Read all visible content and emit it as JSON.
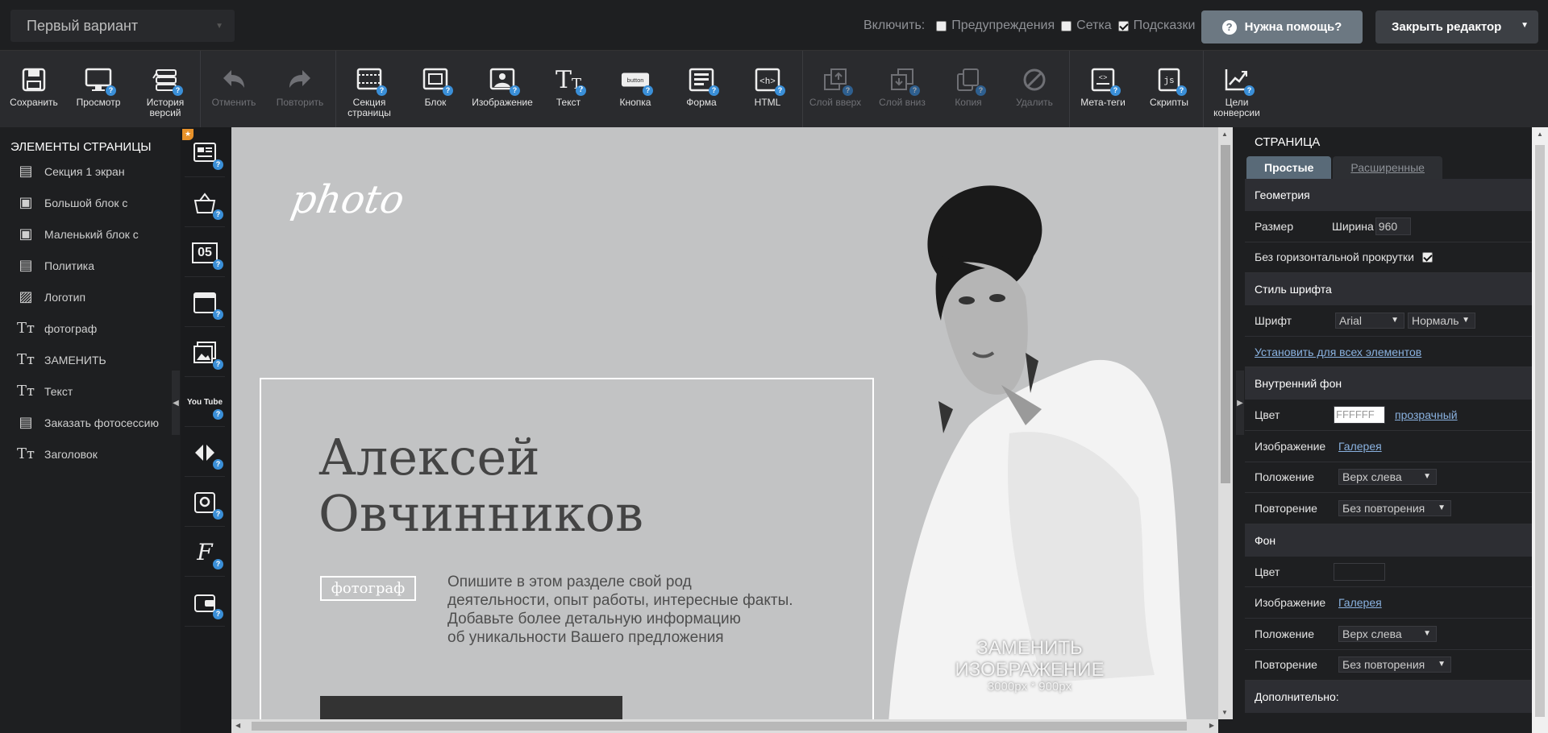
{
  "topbar": {
    "variant": "Первый вариант",
    "toggles_label": "Включить:",
    "toggles": [
      {
        "label": "Предупреждения",
        "checked": false
      },
      {
        "label": "Сетка",
        "checked": false
      },
      {
        "label": "Подсказки",
        "checked": true
      }
    ],
    "help_label": "Нужна помощь?",
    "close_label": "Закрыть редактор"
  },
  "toolbar": {
    "items": [
      {
        "label": "Сохранить",
        "icon": "save-icon",
        "disabled": false
      },
      {
        "label": "Просмотр",
        "icon": "monitor-icon",
        "disabled": false
      },
      {
        "label": "История версий",
        "icon": "history-icon",
        "disabled": false
      },
      {
        "label": "Отменить",
        "icon": "undo-icon",
        "disabled": true
      },
      {
        "label": "Повторить",
        "icon": "redo-icon",
        "disabled": true
      },
      {
        "label": "Секция страницы",
        "icon": "section-icon",
        "disabled": false
      },
      {
        "label": "Блок",
        "icon": "block-icon",
        "disabled": false
      },
      {
        "label": "Изображение",
        "icon": "image-icon",
        "disabled": false
      },
      {
        "label": "Текст",
        "icon": "text-icon",
        "disabled": false
      },
      {
        "label": "Кнопка",
        "icon": "button-icon",
        "disabled": false
      },
      {
        "label": "Форма",
        "icon": "form-icon",
        "disabled": false
      },
      {
        "label": "HTML",
        "icon": "html-icon",
        "disabled": false
      },
      {
        "label": "Слой вверх",
        "icon": "layer-up-icon",
        "disabled": true
      },
      {
        "label": "Слой вниз",
        "icon": "layer-down-icon",
        "disabled": true
      },
      {
        "label": "Копия",
        "icon": "copy-icon",
        "disabled": true
      },
      {
        "label": "Удалить",
        "icon": "delete-icon",
        "disabled": true
      },
      {
        "label": "Мета-теги",
        "icon": "meta-tags-icon",
        "disabled": false
      },
      {
        "label": "Скрипты",
        "icon": "scripts-icon",
        "disabled": false
      },
      {
        "label": "Цели конверсии",
        "icon": "conversion-icon",
        "disabled": false
      }
    ]
  },
  "left_panel": {
    "title": "ЭЛЕМЕНТЫ СТРАНИЦЫ",
    "items": [
      {
        "label": "Секция 1 экран",
        "icon": "section-icon"
      },
      {
        "label": "Большой блок с",
        "icon": "block-icon"
      },
      {
        "label": "Маленький блок с",
        "icon": "block-icon"
      },
      {
        "label": "Политика",
        "icon": "section-icon"
      },
      {
        "label": "Логотип",
        "icon": "image-icon"
      },
      {
        "label": "фотограф",
        "icon": "text-icon"
      },
      {
        "label": "ЗАМЕНИТЬ",
        "icon": "text-icon"
      },
      {
        "label": "Текст",
        "icon": "text-icon"
      },
      {
        "label": "Заказать фотосессию",
        "icon": "section-icon"
      },
      {
        "label": "Заголовок",
        "icon": "text-icon"
      }
    ]
  },
  "widgets": [
    {
      "icon": "text-widget-icon"
    },
    {
      "icon": "basket-widget-icon"
    },
    {
      "icon": "timer-widget-icon",
      "text": "05"
    },
    {
      "icon": "popup-widget-icon"
    },
    {
      "icon": "gallery-widget-icon"
    },
    {
      "icon": "youtube-widget-icon",
      "text": "You Tube"
    },
    {
      "icon": "slider-widget-icon"
    },
    {
      "icon": "map-widget-icon"
    },
    {
      "icon": "font-widget-icon"
    },
    {
      "icon": "wallet-widget-icon"
    }
  ],
  "canvas": {
    "logo": "photo",
    "heading_line1": "Алексей",
    "heading_line2": "Овчинников",
    "tag": "фотограф",
    "desc_lines": [
      "Опишите в этом разделе свой род",
      "деятельности, опыт работы, интересные факты.",
      "Добавьте более детальную информацию",
      "об уникальности Вашего предложения"
    ],
    "replace_line1": "ЗАМЕНИТЬ",
    "replace_line2": "ИЗОБРАЖЕНИЕ",
    "replace_size": "3000px * 900px"
  },
  "right_panel": {
    "title": "СТРАНИЦА",
    "tab_simple": "Простые",
    "tab_advanced": "Расширенные",
    "geometry": "Геометрия",
    "size_label": "Размер",
    "width_label": "Ширина",
    "width_value": "960",
    "no_hscroll": "Без горизонтальной прокрутки",
    "no_hscroll_checked": true,
    "font_style": "Стиль шрифта",
    "font_label": "Шрифт",
    "font_value": "Arial",
    "font_weight": "Нормаль",
    "apply_all": "Установить для всех элементов",
    "inner_bg": "Внутренний фон",
    "color_label": "Цвет",
    "color_value": "FFFFFF",
    "transparent": "прозрачный",
    "image_label": "Изображение",
    "gallery": "Галерея",
    "position_label": "Положение",
    "position_value": "Верх слева",
    "repeat_label": "Повторение",
    "repeat_value": "Без повторения",
    "bg": "Фон",
    "extra": "Дополнительно:"
  },
  "colors": {
    "help_button": "#6c7882",
    "close_button": "#3c3f44",
    "badge": "#3a8fd8",
    "active_tab": "#596a78",
    "star_badge": "#e8922a"
  }
}
